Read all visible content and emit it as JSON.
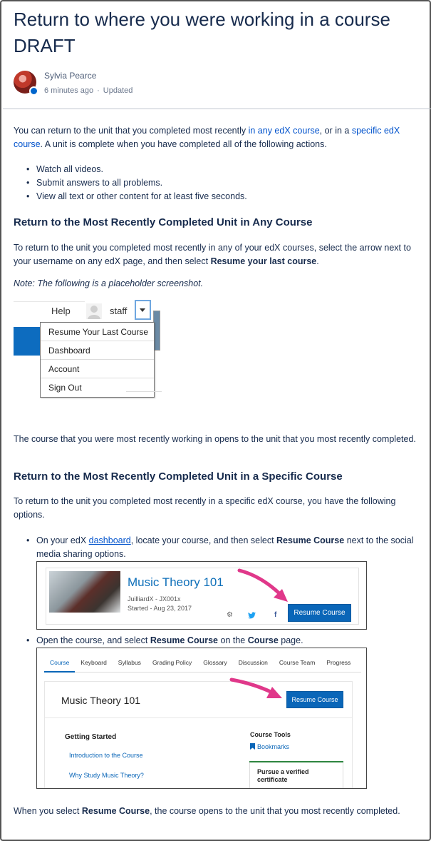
{
  "page": {
    "title": "Return to where you were working in a course DRAFT",
    "author": "Sylvia Pearce",
    "time": "6 minutes ago",
    "meta_sep": "·",
    "status": "Updated"
  },
  "intro": {
    "prefix": "You can return to the unit that you completed most recently ",
    "link1": "in any edX course",
    "mid": ", or in a ",
    "link2": "specific edX course",
    "suffix": ". A unit is complete when you have completed all of the following actions."
  },
  "bullets": [
    "Watch all videos.",
    "Submit answers to all problems.",
    "View all text or other content for at least five seconds."
  ],
  "section1": {
    "heading": "Return to the Most Recently Completed Unit in Any Course",
    "text_prefix": "To return to the unit you completed most recently in any of your edX courses, select the arrow next to your username on any edX page, and then select ",
    "text_bold": "Resume your last course",
    "text_suffix": ".",
    "note": "Note: The following is a placeholder screenshot."
  },
  "menu_shot": {
    "help": "Help",
    "user": "staff",
    "items": [
      "Resume Your Last Course",
      "Dashboard",
      "Account",
      "Sign Out"
    ]
  },
  "after_menu": "The course that you were most recently working in opens to the unit that you most recently completed.",
  "section2": {
    "heading": "Return to the Most Recently Completed Unit in a Specific Course",
    "text": "To return to the unit you completed most recently in a specific edX course, you have the following options.",
    "option1_prefix": "On your edX ",
    "option1_link": "dashboard",
    "option1_mid": ", locate your course, and then select ",
    "option1_bold": "Resume Course",
    "option1_suffix": " next to the social media sharing options.",
    "option2_prefix": "Open the course, and select ",
    "option2_bold1": "Resume Course",
    "option2_mid": " on the ",
    "option2_bold2": "Course",
    "option2_suffix": " page."
  },
  "card_shot": {
    "course_title": "Music Theory 101",
    "course_id": "JuilliardX - JX001x",
    "started": "Started - Aug 23, 2017",
    "gear": "⚙",
    "twitter": "🐦",
    "facebook": "f",
    "button": "Resume Course"
  },
  "course_shot": {
    "tabs": [
      "Course",
      "Keyboard",
      "Syllabus",
      "Grading Policy",
      "Glossary",
      "Discussion",
      "Course Team",
      "Progress"
    ],
    "title": "Music Theory 101",
    "button": "Resume Course",
    "getting_started": "Getting Started",
    "links": [
      "Introduction to the Course",
      "Why Study Music Theory?"
    ],
    "tools": "Course Tools",
    "bookmarks": "Bookmarks",
    "verify": "Pursue a verified certificate"
  },
  "closing": {
    "prefix": "When you select ",
    "bold": "Resume Course",
    "suffix": ", the course opens to the unit that you most recently completed."
  },
  "colors": {
    "link": "#0052cc",
    "edx_blue": "#0a66b8",
    "arrow": "#e0388a"
  }
}
